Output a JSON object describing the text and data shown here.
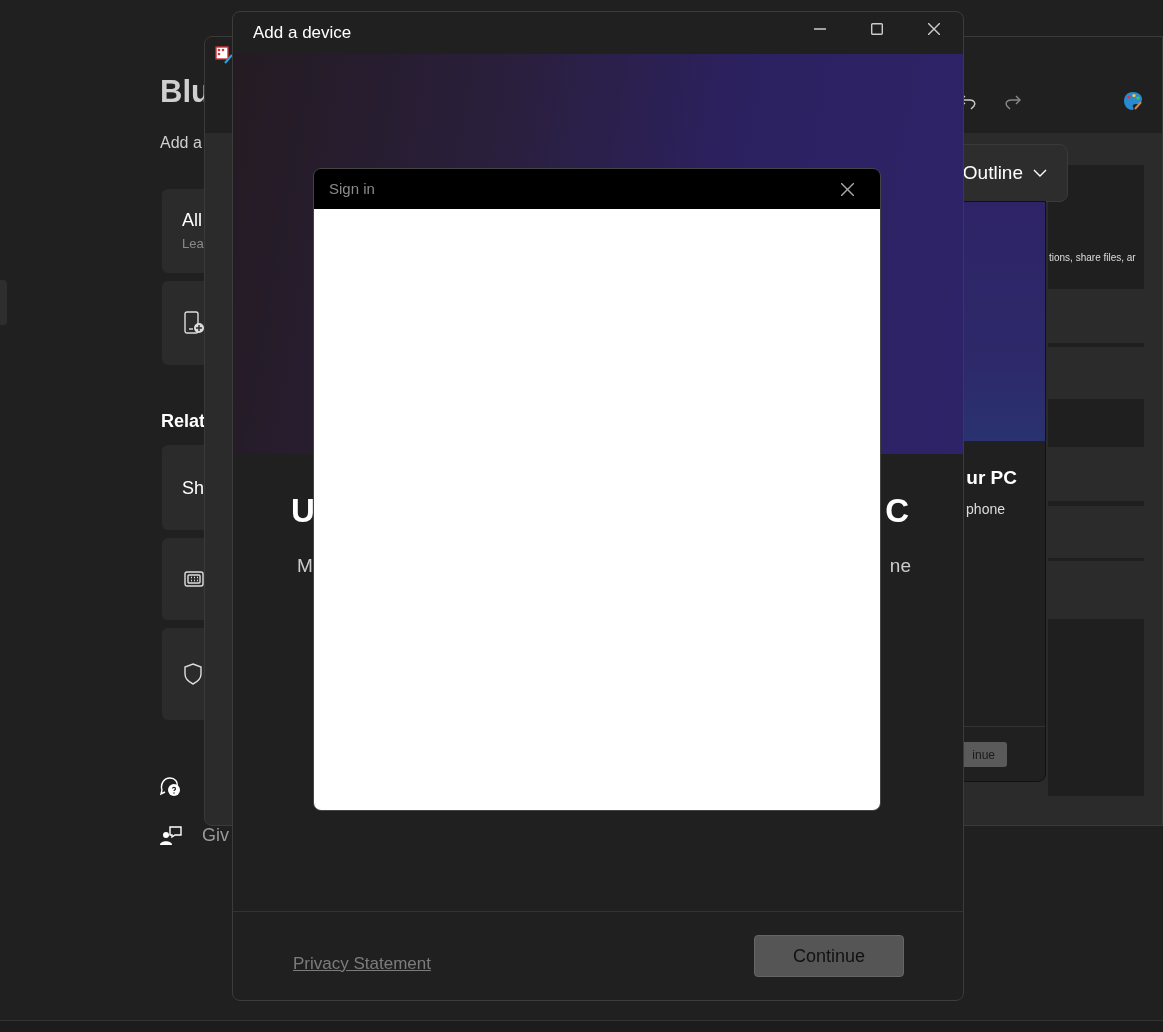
{
  "settings": {
    "title": "Blu",
    "subtitle": "Add a",
    "cards": [
      {
        "kind": "text",
        "title": "All",
        "description": "Lea"
      },
      {
        "kind": "icon"
      }
    ],
    "related": {
      "heading": "Relat",
      "cards": [
        {
          "kind": "text",
          "title": "Sh"
        },
        {
          "kind": "icon"
        },
        {
          "kind": "icon"
        }
      ]
    },
    "links": [
      {
        "kind": "icon"
      },
      {
        "kind": "text",
        "label": "Giv"
      }
    ]
  },
  "paint_window": {
    "dropdown": "Outline",
    "canvas_text": "tions, share files, ar"
  },
  "back_dialog": {
    "heading": "ur PC",
    "subtitle": "phone",
    "button": "inue"
  },
  "dialog": {
    "title": "Add a device",
    "heading": [
      "U",
      "C"
    ],
    "subtitle": [
      "M",
      "ne"
    ],
    "privacy_link": "Privacy Statement",
    "continue_button": "Continue"
  },
  "sign_in": {
    "title": "Sign in"
  }
}
